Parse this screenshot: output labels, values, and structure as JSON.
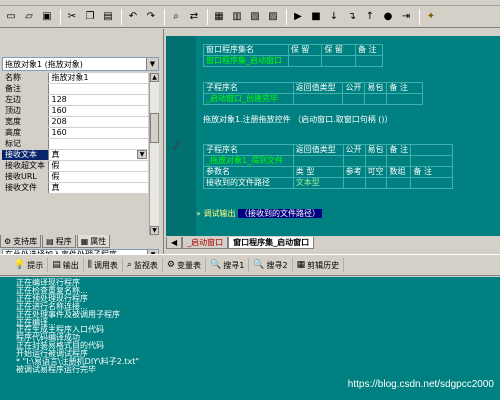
{
  "toolbar": {
    "icons": [
      "new-icon",
      "open-icon",
      "save-icon",
      "cut-icon",
      "copy-icon",
      "paste-icon",
      "undo-icon",
      "redo-icon",
      "find-icon",
      "replace-icon",
      "window-icon",
      "window-icon",
      "window-icon",
      "window-icon",
      "run-icon",
      "stop-icon",
      "step-icon",
      "step-over-icon",
      "step-out-icon",
      "breakpoint-icon",
      "help-icon"
    ]
  },
  "properties": {
    "selected_object": "拖放对象1 (拖放对象)",
    "rows": [
      {
        "name": "名称",
        "value": "拖放对象1"
      },
      {
        "name": "备注",
        "value": ""
      },
      {
        "name": "左边",
        "value": "128"
      },
      {
        "name": "顶边",
        "value": "160"
      },
      {
        "name": "宽度",
        "value": "208"
      },
      {
        "name": "高度",
        "value": "160"
      },
      {
        "name": "标记",
        "value": ""
      },
      {
        "name": "接收文本",
        "value": "真"
      },
      {
        "name": "接收超文本",
        "value": "假"
      },
      {
        "name": "接收URL",
        "value": "假"
      },
      {
        "name": "接收文件",
        "value": "真"
      }
    ],
    "event_select": "在此处选择加入事件处理子程序",
    "tabs": [
      "支持库",
      "程序",
      "属性"
    ]
  },
  "code": {
    "assembly_header": [
      "窗口程序集名",
      "保 留",
      "保 留",
      "备 注"
    ],
    "assembly_row": [
      "窗口程序集_启动窗口",
      "",
      "",
      ""
    ],
    "sub1_header": [
      "子程序名",
      "返回值类型",
      "公开",
      "易包",
      "备 注"
    ],
    "sub1_row": [
      "_启动窗口_创建完毕",
      "",
      "",
      "",
      ""
    ],
    "sub1_line_prefix": "拖放对象1.注册拖放控件",
    "sub1_line_args": "（启动窗口.取窗口句柄 ()）",
    "sub2_header": [
      "子程序名",
      "返回值类型",
      "公开",
      "易包",
      "备 注"
    ],
    "sub2_row": [
      "_拖放对象1_得到文件",
      "",
      "",
      "",
      ""
    ],
    "param_header": [
      "参数名",
      "类 型",
      "参考",
      "可空",
      "数组",
      "备 注"
    ],
    "param_row": [
      "接收到的文件路径",
      "文本型",
      "",
      "",
      "",
      ""
    ],
    "debug_line_cmd": "调试输出",
    "debug_line_arg": "（接收到的文件路径）",
    "tabs": [
      "_启动窗口",
      "窗口程序集_启动窗口"
    ]
  },
  "output": {
    "tabs": [
      {
        "icon": "tip-icon",
        "label": "提示"
      },
      {
        "icon": "output-icon",
        "label": "输出"
      },
      {
        "icon": "call-table-icon",
        "label": "调用表"
      },
      {
        "icon": "watch-icon",
        "label": "监视表"
      },
      {
        "icon": "var-table-icon",
        "label": "变量表"
      },
      {
        "icon": "search1-icon",
        "label": "搜寻1"
      },
      {
        "icon": "search2-icon",
        "label": "搜寻2"
      },
      {
        "icon": "clipboard-icon",
        "label": "剪辑历史"
      }
    ],
    "lines": [
      "正在编译现行程序",
      "正在检查重复名称...",
      "正在预处理现行程序",
      "正在进行名称连接...",
      "正在处理事件及被调用子程序",
      "正在编译...",
      "正在生成主程序入口代码",
      "程序代码编译成功",
      "正在封装易格式目的代码",
      "开始运行被调试程序",
      "* \"I:\\易语言\\注册机DIY\\料子2.txt\"",
      "被调试易程序运行完毕"
    ],
    "watermark": "https://blog.csdn.net/sdgpcc2000"
  }
}
